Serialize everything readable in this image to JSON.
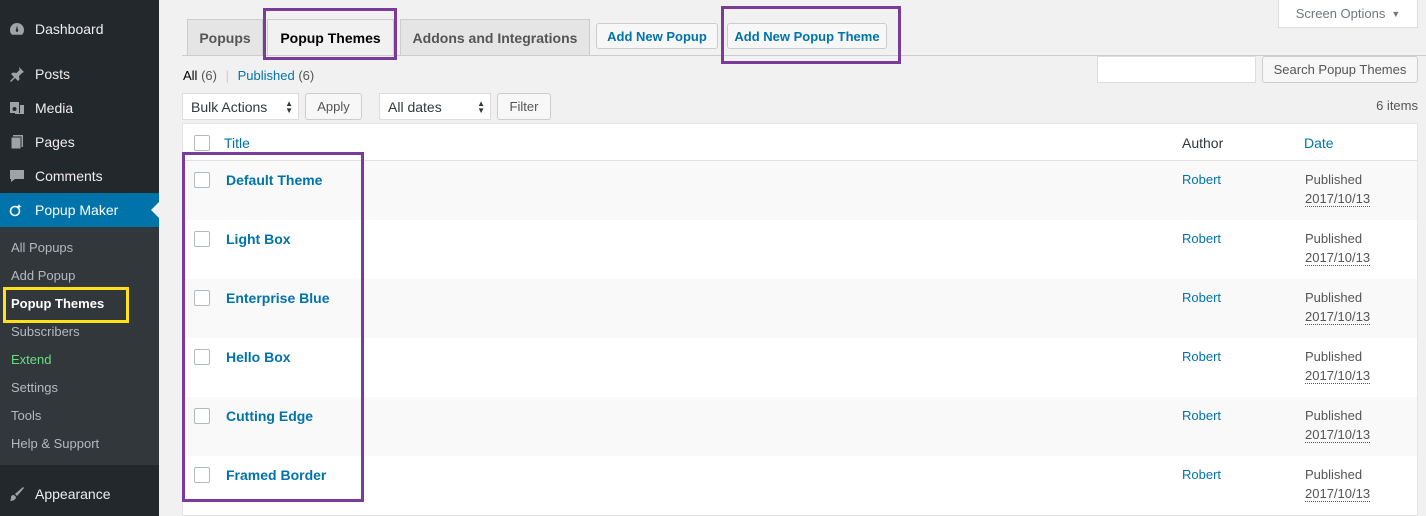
{
  "sidebar": {
    "top_items": [
      {
        "label": "Dashboard",
        "icon": "dashboard-icon"
      },
      {
        "label": "Posts",
        "icon": "pin-icon"
      },
      {
        "label": "Media",
        "icon": "media-icon"
      },
      {
        "label": "Pages",
        "icon": "pages-icon"
      },
      {
        "label": "Comments",
        "icon": "comment-icon"
      },
      {
        "label": "Popup Maker",
        "icon": "popup-maker-icon"
      }
    ],
    "submenu": [
      "All Popups",
      "Add Popup",
      "Popup Themes",
      "Subscribers",
      "Extend",
      "Settings",
      "Tools",
      "Help & Support"
    ],
    "appearance": {
      "label": "Appearance",
      "icon": "paintbrush-icon"
    }
  },
  "tabs": [
    "Popups",
    "Popup Themes",
    "Addons and Integrations"
  ],
  "tab_buttons": {
    "add_popup": "Add New Popup",
    "add_theme": "Add New Popup Theme"
  },
  "screen_options": "Screen Options",
  "views": {
    "all_label": "All",
    "all_count": "(6)",
    "separator": "|",
    "published_label": "Published",
    "published_count": "(6)"
  },
  "search": {
    "value": "",
    "button": "Search Popup Themes"
  },
  "bulk": {
    "select": "Bulk Actions",
    "apply": "Apply"
  },
  "dates": {
    "select": "All dates",
    "filter": "Filter"
  },
  "items_count": "6 items",
  "table": {
    "columns": {
      "title": "Title",
      "author": "Author",
      "date": "Date"
    },
    "rows": [
      {
        "title": "Default Theme",
        "author": "Robert",
        "status": "Published",
        "date": "2017/10/13"
      },
      {
        "title": "Light Box",
        "author": "Robert",
        "status": "Published",
        "date": "2017/10/13"
      },
      {
        "title": "Enterprise Blue",
        "author": "Robert",
        "status": "Published",
        "date": "2017/10/13"
      },
      {
        "title": "Hello Box",
        "author": "Robert",
        "status": "Published",
        "date": "2017/10/13"
      },
      {
        "title": "Cutting Edge",
        "author": "Robert",
        "status": "Published",
        "date": "2017/10/13"
      },
      {
        "title": "Framed Border",
        "author": "Robert",
        "status": "Published",
        "date": "2017/10/13"
      }
    ]
  },
  "colors": {
    "sidebar_bg": "#23282d",
    "submenu_bg": "#32373c",
    "accent": "#0073aa",
    "highlight_purple": "#7a3c9b",
    "highlight_yellow": "#ffe11a",
    "extend_green": "#68de7c"
  }
}
